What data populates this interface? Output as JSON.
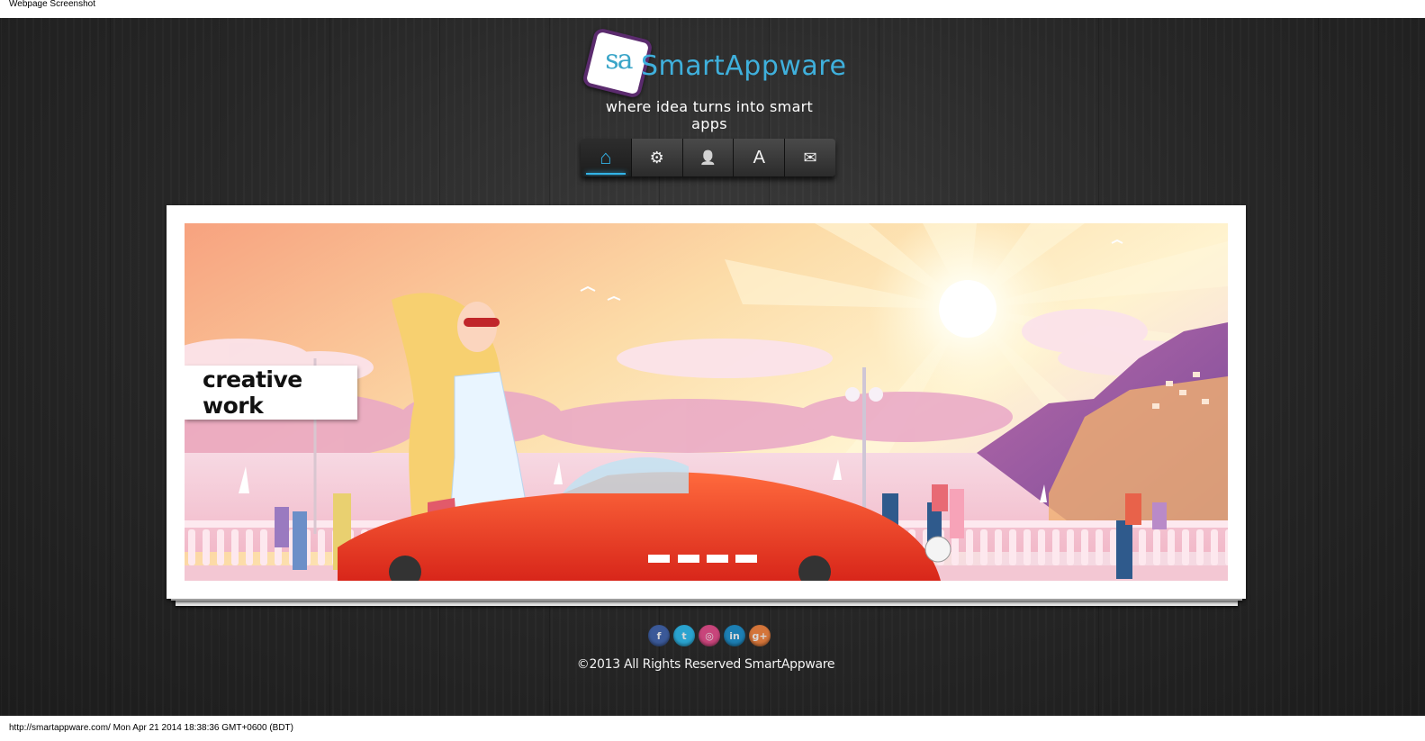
{
  "capture": {
    "title": "Webpage Screenshot",
    "footer": "http://smartappware.com/ Mon Apr 21 2014 18:38:36 GMT+0600 (BDT)"
  },
  "header": {
    "logo_mark": "sa",
    "logo_name": "SmartAppware",
    "tagline": "where idea turns into smart apps"
  },
  "nav": {
    "items": [
      {
        "name": "home",
        "icon": "home-icon",
        "glyph": "⌂",
        "active": true
      },
      {
        "name": "services",
        "icon": "gears-icon",
        "glyph": "⚙",
        "active": false
      },
      {
        "name": "about",
        "icon": "user-icon",
        "glyph": "👤",
        "active": false
      },
      {
        "name": "apps",
        "icon": "letter-a-icon",
        "glyph": "A",
        "active": false
      },
      {
        "name": "contact",
        "icon": "envelope-icon",
        "glyph": "✉",
        "active": false
      }
    ],
    "active_color": "#33b4e8"
  },
  "slider": {
    "caption": "creative work"
  },
  "social": [
    {
      "name": "facebook",
      "icon": "facebook-icon",
      "glyph": "f",
      "color": "#3b5998"
    },
    {
      "name": "twitter",
      "icon": "twitter-icon",
      "glyph": "t",
      "color": "#2aa3cf"
    },
    {
      "name": "dribbble",
      "icon": "dribbble-icon",
      "glyph": "◎",
      "color": "#c8457b"
    },
    {
      "name": "linkedin",
      "icon": "linkedin-icon",
      "glyph": "in",
      "color": "#1d7fb3"
    },
    {
      "name": "google-plus",
      "icon": "google-plus-icon",
      "glyph": "g+",
      "color": "#d4753a"
    }
  ],
  "footer": {
    "copyright": "©2013 All Rights Reserved SmartAppware"
  },
  "colors": {
    "brand": "#3fb0dc",
    "background": "#262626"
  }
}
